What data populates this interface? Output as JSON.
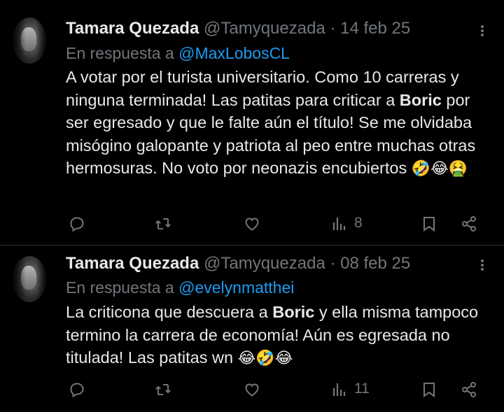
{
  "tweets": [
    {
      "name": "Tamara Quezada",
      "handle": "@Tamyquezada",
      "separator": "·",
      "date": "14 feb 25",
      "reply_prefix": "En respuesta a",
      "reply_to": "@MaxLobosCL",
      "text_parts": [
        "A votar por el turista universitario. Como 10 carreras y ninguna terminada! Las patitas para criticar a ",
        "Boric",
        " por ser egresado y que le falte aún el título! Se me olvidaba misógino galopante y patriota al peo entre muchas otras hermosuras. No voto por neonazis encubiertos "
      ],
      "emojis": "🤣😂🤮",
      "views": "8"
    },
    {
      "name": "Tamara Quezada",
      "handle": "@Tamyquezada",
      "separator": "·",
      "date": "08 feb 25",
      "reply_prefix": "En respuesta a",
      "reply_to": "@evelynmatthei",
      "text_parts": [
        "La criticona que descuera a ",
        "Boric",
        " y ella misma tampoco termino la carrera de economía! Aún es egresada no titulada! Las patitas wn "
      ],
      "emojis": "😂🤣😂",
      "views": "11"
    }
  ],
  "icons": {
    "reply": "reply-icon",
    "retweet": "retweet-icon",
    "like": "heart-icon",
    "views": "views-icon",
    "bookmark": "bookmark-icon",
    "share": "share-icon",
    "more": "more-icon"
  },
  "colors": {
    "background": "#000000",
    "text": "#e7e9ea",
    "muted": "#71767b",
    "link": "#1d9bf0",
    "divider": "#2f3336"
  }
}
